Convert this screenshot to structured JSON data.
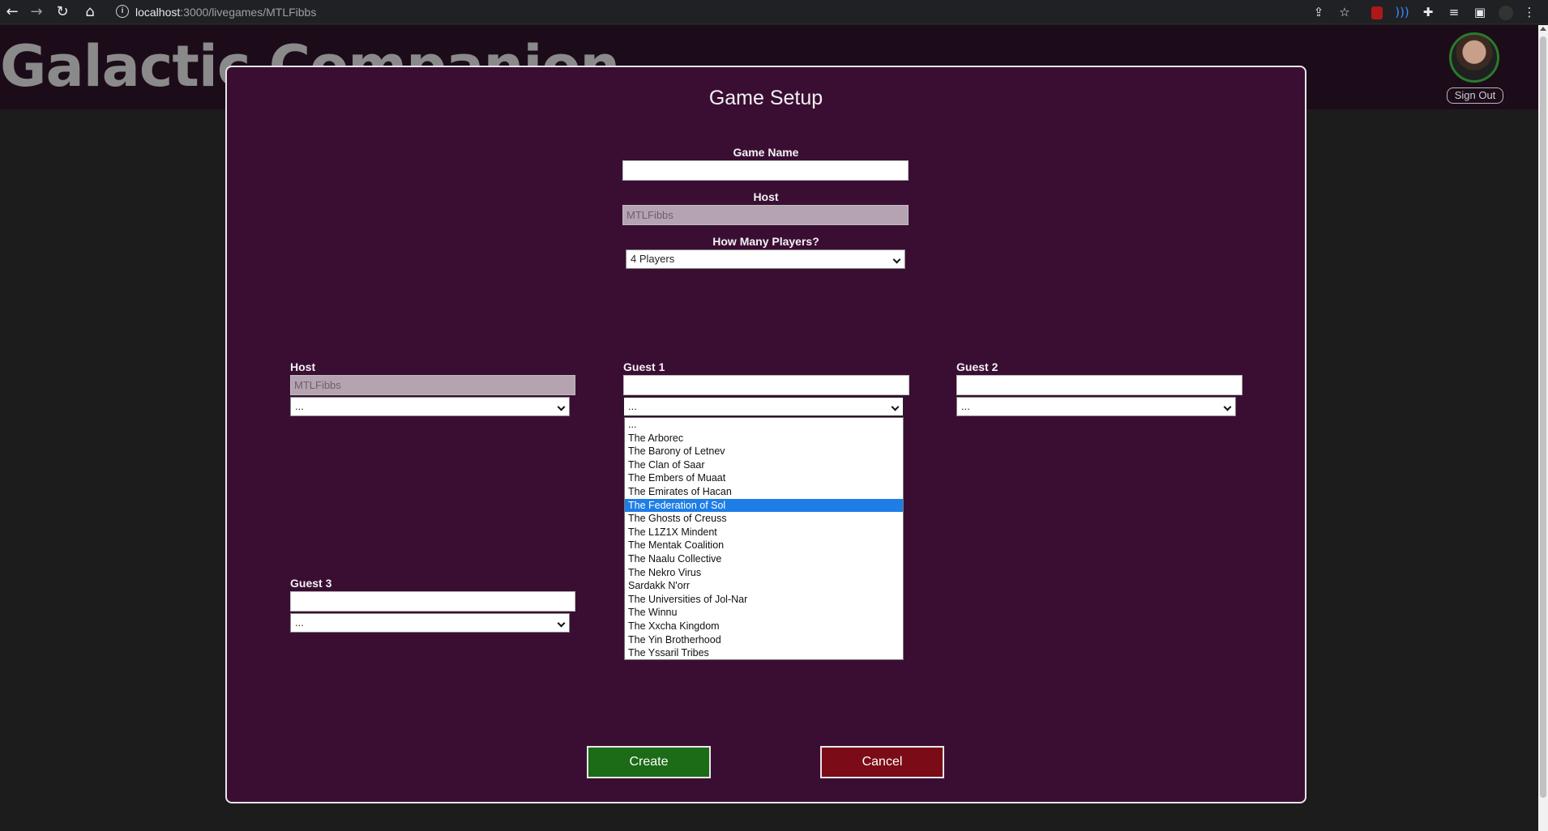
{
  "browser": {
    "url_host": "localhost",
    "url_path": ":3000/livegames/MTLFibbs",
    "nav_icons": [
      "back-icon",
      "forward-icon",
      "reload-icon",
      "home-icon"
    ],
    "ext_icons": [
      "share-icon",
      "star-icon",
      "ublock-icon",
      "extension-wave-icon",
      "puzzle-icon",
      "reading-list-icon",
      "sidepanel-icon",
      "profile-icon",
      "menu-icon"
    ]
  },
  "header": {
    "title": "Galactic Companion",
    "sign_out": "Sign Out"
  },
  "modal": {
    "title": "Game Setup",
    "game_name_label": "Game Name",
    "game_name_value": "",
    "host_label": "Host",
    "host_value": "MTLFibbs",
    "players_label": "How Many Players?",
    "players_value": "4 Players",
    "players_section": [
      {
        "label": "Host",
        "name_value": "MTLFibbs",
        "faction_value": "..."
      },
      {
        "label": "Guest 1",
        "name_value": "",
        "faction_value": "..."
      },
      {
        "label": "Guest 2",
        "name_value": "",
        "faction_value": "..."
      },
      {
        "label": "Guest 3",
        "name_value": "",
        "faction_value": "..."
      }
    ],
    "faction_options": [
      "...",
      "The Arborec",
      "The Barony of Letnev",
      "The Clan of Saar",
      "The Embers of Muaat",
      "The Emirates of Hacan",
      "The Federation of Sol",
      "The Ghosts of Creuss",
      "The L1Z1X Mindent",
      "The Mentak Coalition",
      "The Naalu Collective",
      "The Nekro Virus",
      "Sardakk N'orr",
      "The Universities of Jol-Nar",
      "The Winnu",
      "The Xxcha Kingdom",
      "The Yin Brotherhood",
      "The Yssaril Tribes"
    ],
    "highlighted_option": "The Federation of Sol",
    "create_label": "Create",
    "cancel_label": "Cancel",
    "colors": {
      "modal_bg": "#3a0e33",
      "create_bg": "#1c6b16",
      "cancel_bg": "#7a0b17",
      "highlight": "#1e7de6"
    }
  }
}
